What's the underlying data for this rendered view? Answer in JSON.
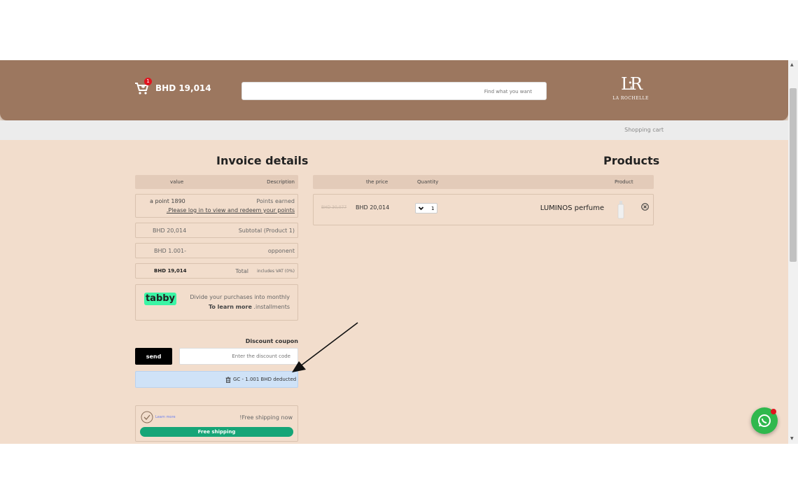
{
  "header": {
    "cart_count": "1",
    "cart_total": "BHD 19,014",
    "search_placeholder": "Find what you want",
    "logo_text": "LA ROCHELLE",
    "brand_color": "#9c775f"
  },
  "breadcrumb": "Shopping cart",
  "invoice": {
    "title": "Invoice details",
    "col_value": "value",
    "col_description": "Description",
    "points_value": "a point 1890",
    "points_label": "Points earned",
    "points_login": ".Please log in to view and redeem your points",
    "subtotal_value": "BHD 20,014",
    "subtotal_label": "Subtotal (Product 1)",
    "opponent_value": "BHD 1.001-",
    "opponent_label": "opponent",
    "total_value": "BHD 19,014",
    "total_label": "Total",
    "total_note": "includes VAT (0%)"
  },
  "tabby": {
    "logo": "tabby",
    "line1": "Divide your purchases into monthly",
    "learn_more": "To learn more",
    "line2_rest": ".installments"
  },
  "coupon": {
    "title": "Discount coupon",
    "send_label": "send",
    "input_placeholder": "Enter the discount code",
    "deducted_text": "GC - 1.001 BHD deducted"
  },
  "shipping": {
    "learn_more": "Learn more",
    "label": "!Free shipping now",
    "bar_label": "Free shipping"
  },
  "products": {
    "title": "Products",
    "col_price": "the price",
    "col_quantity": "Quantity",
    "col_product": "Product",
    "items": [
      {
        "old_price": "BHD 30,077",
        "price": "BHD 20,014",
        "quantity": "1",
        "name": "LUMINOS perfume"
      }
    ]
  }
}
